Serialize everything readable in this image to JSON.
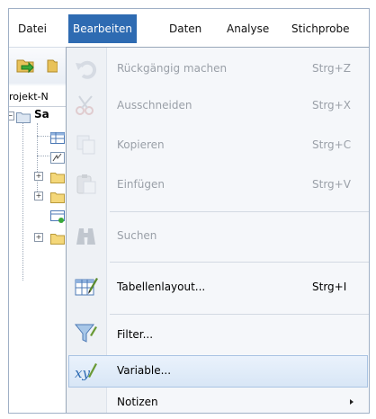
{
  "menubar": {
    "items": [
      {
        "label": "Datei"
      },
      {
        "label": "Bearbeiten"
      },
      {
        "label": "Daten"
      },
      {
        "label": "Analyse"
      },
      {
        "label": "Stichprobe"
      }
    ],
    "active": "Bearbeiten"
  },
  "project": {
    "title": "rojekt-N",
    "root_label": "Sa"
  },
  "edit_menu": {
    "items": [
      {
        "label": "Rückgängig machen",
        "shortcut": "Strg+Z",
        "enabled": false,
        "icon": "undo-icon"
      },
      {
        "label": "Ausschneiden",
        "shortcut": "Strg+X",
        "enabled": false,
        "icon": "scissors-icon"
      },
      {
        "label": "Kopieren",
        "shortcut": "Strg+C",
        "enabled": false,
        "icon": "copy-icon"
      },
      {
        "label": "Einfügen",
        "shortcut": "Strg+V",
        "enabled": false,
        "icon": "paste-icon"
      },
      {
        "label": "Suchen",
        "shortcut": "",
        "enabled": false,
        "icon": "binoculars-icon"
      },
      {
        "label": "Tabellenlayout...",
        "shortcut": "Strg+I",
        "enabled": true,
        "icon": "table-layout-icon"
      },
      {
        "label": "Filter...",
        "shortcut": "",
        "enabled": true,
        "icon": "filter-icon"
      },
      {
        "label": "Variable...",
        "shortcut": "",
        "enabled": true,
        "icon": "variable-icon",
        "highlighted": true
      },
      {
        "label": "Notizen",
        "shortcut": "",
        "enabled": true,
        "icon": "",
        "submenu": true
      }
    ]
  }
}
